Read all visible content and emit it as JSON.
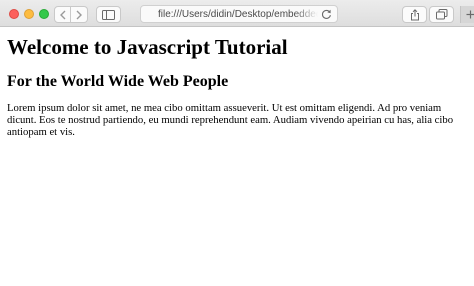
{
  "browser": {
    "address_bar": {
      "url": "file:///Users/didin/Desktop/embedded-fo"
    },
    "icons": {
      "back": "chevron-left-icon",
      "forward": "chevron-right-icon",
      "sidebar": "sidebar-icon",
      "reload": "reload-icon",
      "share": "share-icon",
      "tabs": "tabs-overview-icon",
      "new_tab": "plus-icon"
    }
  },
  "page": {
    "heading": "Welcome to Javascript Tutorial",
    "subheading": "For the World Wide Web People",
    "paragraph": "Lorem ipsum dolor sit amet, ne mea cibo omittam assueverit. Ut est omittam eligendi. Ad pro veniam dicunt. Eos te nostrud partiendo, eu mundi reprehendunt eam. Audiam vivendo apeirian cu has, alia cibo antiopam et vis."
  }
}
